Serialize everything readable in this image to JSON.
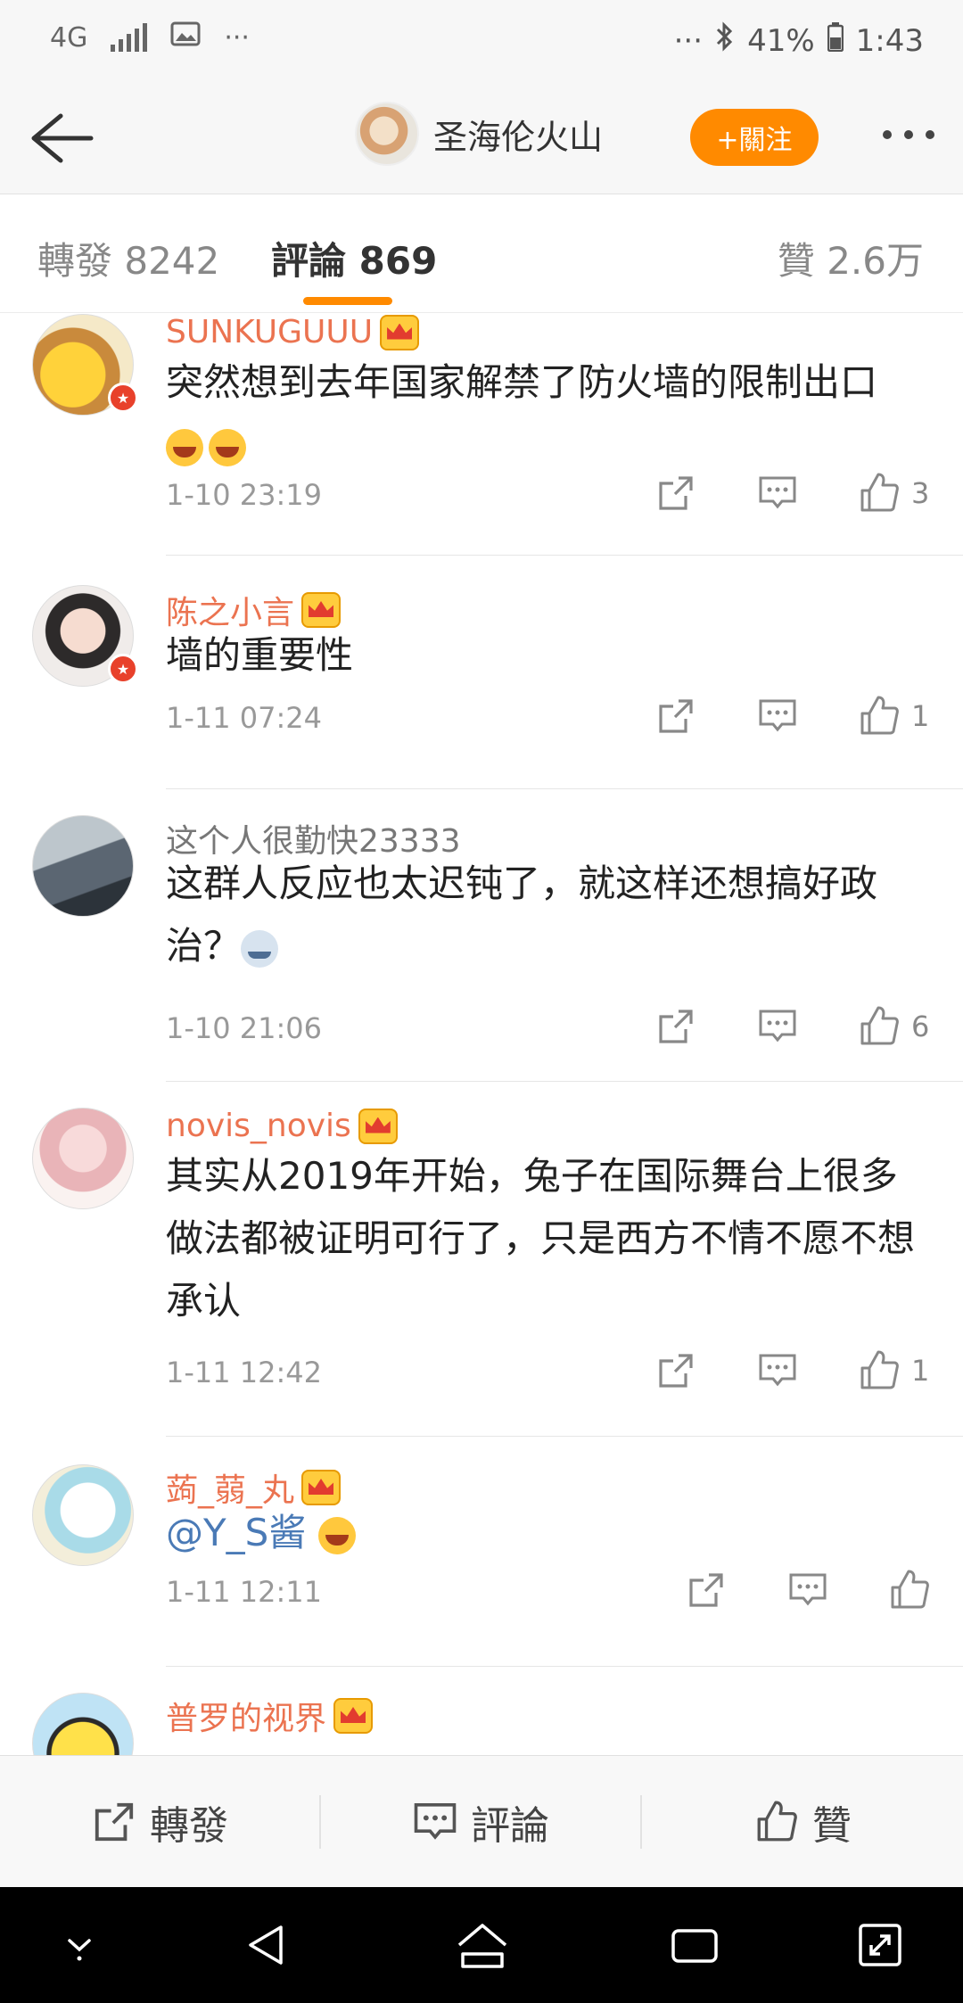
{
  "status_bar": {
    "network": "4G",
    "dots_left": "···",
    "dots_right": "···",
    "battery": "41%",
    "time": "1:43"
  },
  "header": {
    "user_name": "圣海伦火山",
    "follow_label": "+關注"
  },
  "tabs": {
    "repost": "轉發 8242",
    "comments": "評論 869",
    "likes": "贊 2.6万"
  },
  "comments": [
    {
      "name": "SUNKUGUUU",
      "vip": true,
      "verified": true,
      "text": "突然想到去年国家解禁了防火墙的限制出口",
      "emoji": [
        "laugh",
        "laugh"
      ],
      "time": "1-10 23:19",
      "likes": "3"
    },
    {
      "name": "陈之小言",
      "vip": true,
      "verified": true,
      "text": "墙的重要性",
      "emoji": [],
      "time": "1-11 07:24",
      "likes": "1"
    },
    {
      "name": "这个人很勤快23333",
      "vip": false,
      "verified": false,
      "text": "这群人反应也太迟钝了，就这样还想搞好政治？",
      "emoji": [
        "dog"
      ],
      "time": "1-10 21:06",
      "likes": "6"
    },
    {
      "name": "novis_novis",
      "vip": true,
      "verified": false,
      "text": "其实从2019年开始，兔子在国际舞台上很多做法都被证明可行了，只是西方不情不愿不想承认",
      "emoji": [],
      "time": "1-11 12:42",
      "likes": "1"
    },
    {
      "name": "蒟_蒻_丸",
      "vip": true,
      "verified": false,
      "text": "@Y_S酱",
      "emoji": [
        "laugh"
      ],
      "time": "1-11 12:11",
      "likes": ""
    },
    {
      "name": "普罗的视界",
      "vip": true,
      "verified": false,
      "text": "",
      "emoji": [],
      "time": "",
      "likes": ""
    }
  ],
  "bottom_bar": {
    "repost": "轉發",
    "comment": "評論",
    "like": "贊"
  },
  "colors": {
    "accent": "#ff8a00",
    "vip_name": "#eb7350",
    "mention": "#4a7ab6"
  }
}
